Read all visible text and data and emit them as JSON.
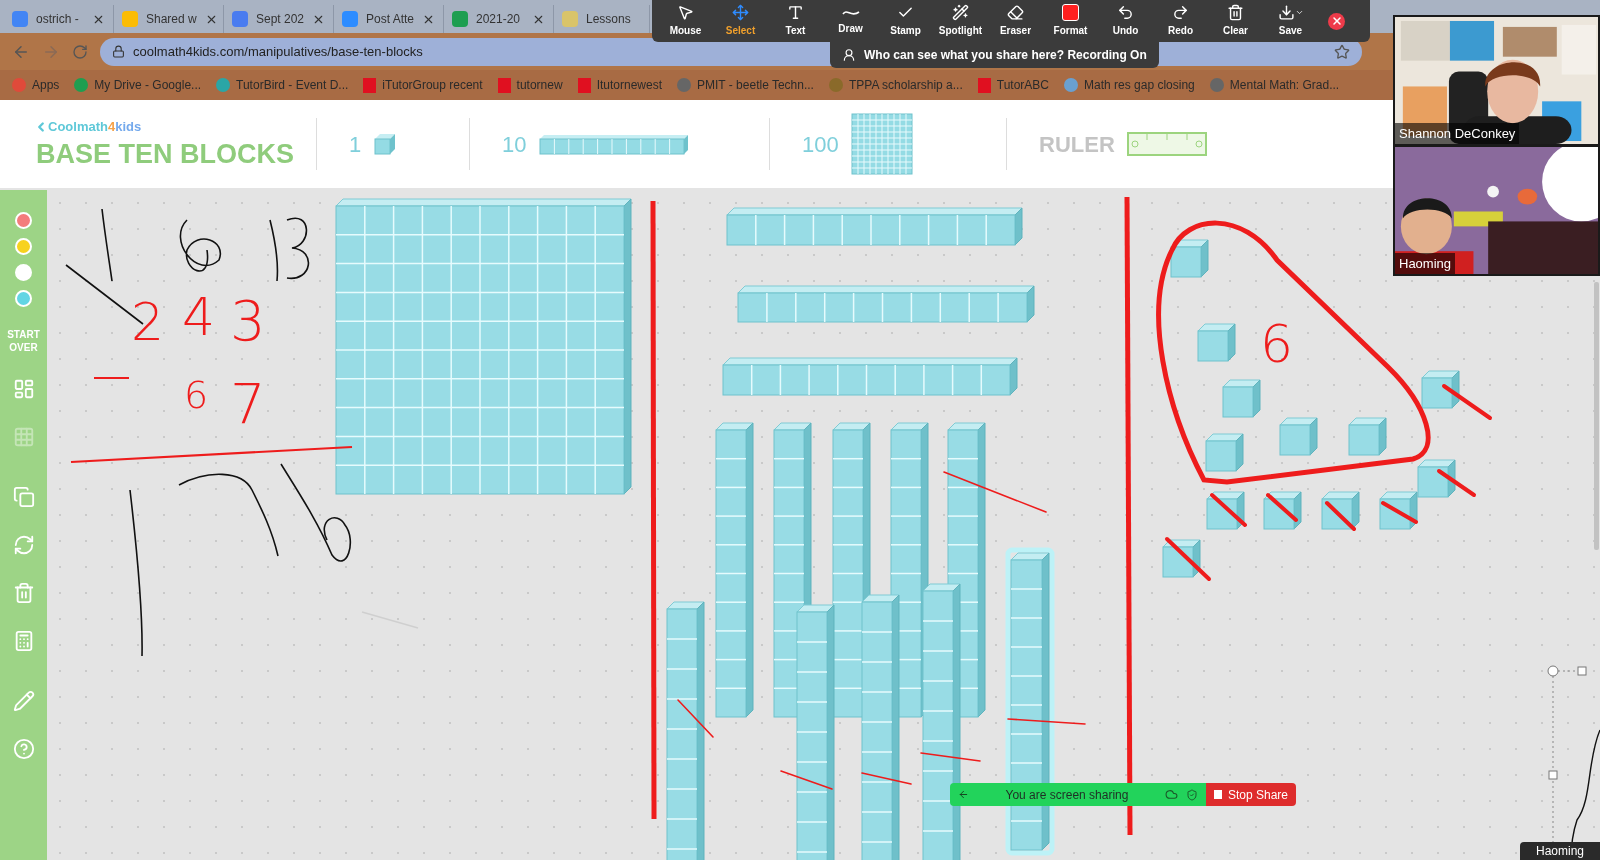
{
  "browser": {
    "tabs": [
      {
        "title": "ostrich -"
      },
      {
        "title": "Shared w"
      },
      {
        "title": "Sept 202"
      },
      {
        "title": "Post Atte"
      },
      {
        "title": "2021-20"
      },
      {
        "title": "Lessons"
      }
    ],
    "url": "coolmath4kids.com/manipulatives/base-ten-blocks",
    "bookmarks": [
      {
        "label": "Apps"
      },
      {
        "label": "My Drive - Google..."
      },
      {
        "label": "TutorBird - Event D..."
      },
      {
        "label": "iTutorGroup recent"
      },
      {
        "label": "tutornew"
      },
      {
        "label": "Itutornewest"
      },
      {
        "label": "PMIT - beetle Techn..."
      },
      {
        "label": "TPPA scholarship a..."
      },
      {
        "label": "TutorABC"
      },
      {
        "label": "Math res gap closing"
      },
      {
        "label": "Mental Math: Grad..."
      }
    ]
  },
  "annotation_toolbar": {
    "tools": [
      {
        "label": "Mouse",
        "selected": false
      },
      {
        "label": "Select",
        "selected": true
      },
      {
        "label": "Text",
        "selected": false
      },
      {
        "label": "Draw",
        "selected": false
      },
      {
        "label": "Stamp",
        "selected": false
      },
      {
        "label": "Spotlight",
        "selected": false
      },
      {
        "label": "Eraser",
        "selected": false
      },
      {
        "label": "Format",
        "selected": false
      },
      {
        "label": "Undo",
        "selected": false
      },
      {
        "label": "Redo",
        "selected": false
      },
      {
        "label": "Clear",
        "selected": false
      },
      {
        "label": "Save",
        "selected": false
      }
    ],
    "notice": "Who can see what you share here? Recording On"
  },
  "videos": [
    {
      "name": "Shannon DeConkey"
    },
    {
      "name": "Haoming"
    }
  ],
  "app": {
    "logo": [
      {
        "text": "Coolmath",
        "color": "#5ec8d8"
      },
      {
        "text": "4",
        "color": "#f5a24a"
      },
      {
        "text": "kids",
        "color": "#74a9ec"
      }
    ],
    "title": "BASE TEN BLOCKS",
    "palette": [
      {
        "kind": "unit",
        "label": "1"
      },
      {
        "kind": "rod",
        "label": "10"
      },
      {
        "kind": "flat",
        "label": "100"
      },
      {
        "kind": "ruler",
        "label": "RULER"
      }
    ],
    "colors": [
      {
        "color": "#f47c7c"
      },
      {
        "color": "#f7d21e"
      },
      {
        "color": "#ffffff"
      },
      {
        "color": "#62d5e4"
      }
    ],
    "start_over": "START OVER",
    "tools": [
      {
        "kind": "blocks",
        "disabled": false
      },
      {
        "kind": "grid",
        "disabled": true
      },
      {
        "kind": "copy",
        "disabled": false
      },
      {
        "kind": "rotate",
        "disabled": false
      },
      {
        "kind": "trash",
        "disabled": false
      },
      {
        "kind": "calculator",
        "disabled": false
      },
      {
        "kind": "pencil",
        "disabled": false
      },
      {
        "kind": "help",
        "disabled": false
      }
    ],
    "canvas": {
      "blocks": [
        {
          "kind": "hundred",
          "selected": false
        },
        {
          "kind": "rod",
          "selected": false
        },
        {
          "kind": "rod",
          "selected": false
        },
        {
          "kind": "rod",
          "selected": false
        },
        {
          "kind": "rod",
          "selected": false
        },
        {
          "kind": "rod",
          "selected": false
        },
        {
          "kind": "rod",
          "selected": false
        },
        {
          "kind": "rod",
          "selected": false
        },
        {
          "kind": "rod",
          "selected": false
        },
        {
          "kind": "rod",
          "selected": false
        },
        {
          "kind": "rod",
          "selected": false
        },
        {
          "kind": "rod",
          "selected": false
        },
        {
          "kind": "rod",
          "selected": false
        },
        {
          "kind": "rod",
          "selected": true
        },
        {
          "kind": "unit",
          "selected": false
        },
        {
          "kind": "unit",
          "selected": false
        },
        {
          "kind": "unit",
          "selected": false
        },
        {
          "kind": "unit",
          "selected": false
        },
        {
          "kind": "unit",
          "selected": false
        },
        {
          "kind": "unit",
          "selected": false
        },
        {
          "kind": "unit",
          "selected": false
        },
        {
          "kind": "unit",
          "selected": false
        },
        {
          "kind": "unit",
          "selected": false
        },
        {
          "kind": "unit",
          "selected": false
        },
        {
          "kind": "unit",
          "selected": false
        },
        {
          "kind": "unit",
          "selected": false
        },
        {
          "kind": "unit",
          "selected": false
        }
      ],
      "handwriting": [
        {
          "text": "2"
        },
        {
          "text": "4"
        },
        {
          "text": "3"
        },
        {
          "text": "6"
        },
        {
          "text": "6"
        },
        {
          "text": "7"
        }
      ]
    }
  },
  "share_bar": {
    "status": "You are screen sharing",
    "stop": "Stop Share"
  },
  "name_tag": "Haoming"
}
